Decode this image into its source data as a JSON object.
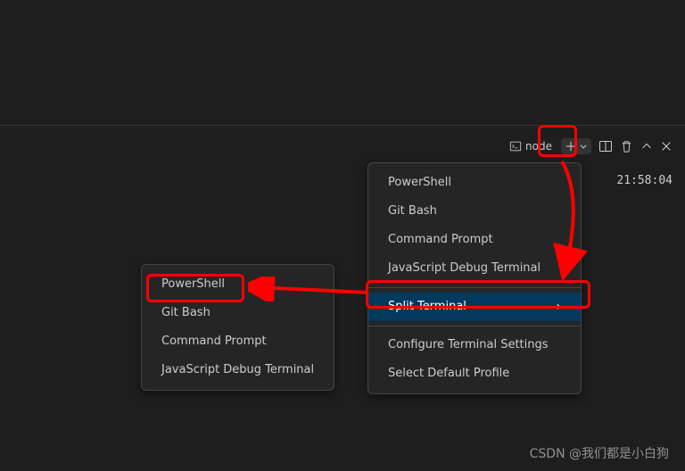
{
  "toolbar": {
    "node_label": "node"
  },
  "menu_main": {
    "items": [
      {
        "label": "PowerShell"
      },
      {
        "label": "Git Bash"
      },
      {
        "label": "Command Prompt"
      },
      {
        "label": "JavaScript Debug Terminal"
      }
    ],
    "split_label": "Split Terminal",
    "configure_label": "Configure Terminal Settings",
    "default_profile_label": "Select Default Profile"
  },
  "menu_sub": {
    "items": [
      {
        "label": "PowerShell"
      },
      {
        "label": "Git Bash"
      },
      {
        "label": "Command Prompt"
      },
      {
        "label": "JavaScript Debug Terminal"
      }
    ]
  },
  "timestamp": "21:58:04",
  "watermark": "CSDN @我们都是小白狗"
}
